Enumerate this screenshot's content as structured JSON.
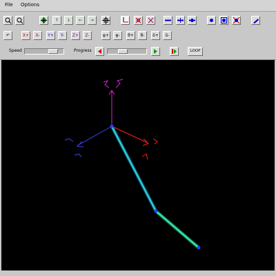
{
  "menu": {
    "file": "File",
    "options": "Options"
  },
  "toolbar1": {
    "zoom_in_icon": "magnifier",
    "zoom_out_icon": "magnifier",
    "arrow_up": "↑",
    "arrow_down": "↓",
    "arrow_left": "←",
    "arrow_right": "→"
  },
  "toolbar2": {
    "reset": "↶",
    "axis_buttons": [
      "X+",
      "X-",
      "Y+",
      "Y-",
      "Z+",
      "Z-"
    ],
    "angle_buttons": [
      "φ+",
      "φ-",
      "θ+",
      "θ-",
      "δ+",
      "δ-"
    ]
  },
  "playback": {
    "speed_label": "Speed",
    "progress_label": "Progress",
    "loop_label": "LOOP",
    "speed_value": 0.8,
    "progress_value": 0.35
  },
  "colors": {
    "background": "#000000",
    "link": "#2ad0c8",
    "axis_x": "#ff2020",
    "axis_y": "#4040ff",
    "axis_z": "#e020e0"
  }
}
